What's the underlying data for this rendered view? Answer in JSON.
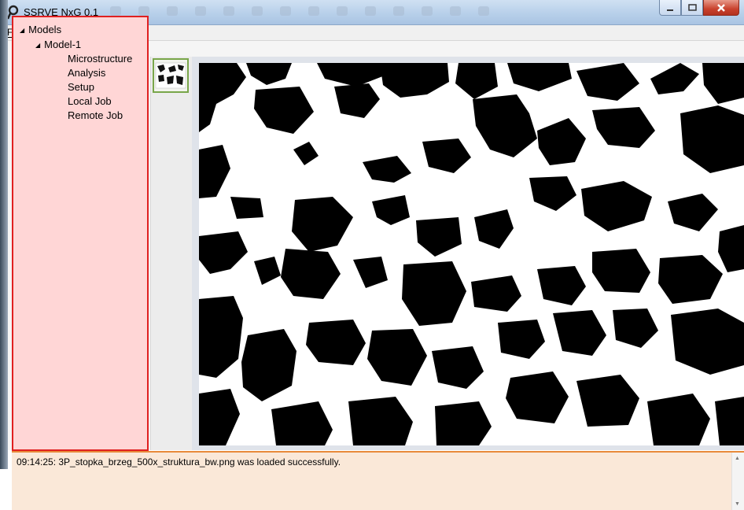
{
  "window": {
    "title": "SSRVE NxG 0.1",
    "controls": [
      "minimize-icon",
      "maximize-icon",
      "close-icon"
    ]
  },
  "menu": {
    "file_label": "File"
  },
  "tree": {
    "root": "Models",
    "model": "Model-1",
    "items": [
      "Microstructure",
      "Analysis",
      "Setup",
      "Local Job",
      "Remote Job"
    ]
  },
  "thumbnail": {
    "label": "microstructure-thumbnail"
  },
  "log": {
    "message": "09:14:25: 3P_stopka_brzeg_500x_struktura_bw.png was loaded successfully."
  },
  "colors": {
    "tree_bg": "#ffd6d6",
    "tree_border": "#e02020",
    "log_bg": "#fae8d8",
    "log_border": "#e88a3a",
    "thumb_border": "#79a64a"
  }
}
